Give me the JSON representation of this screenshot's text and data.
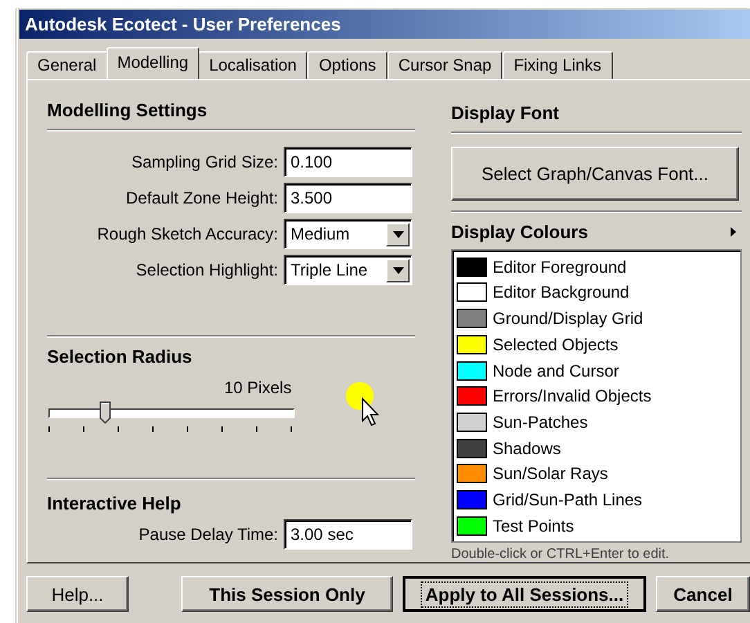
{
  "window": {
    "title": "Autodesk Ecotect - User Preferences"
  },
  "tabs": [
    {
      "label": "General",
      "selected": false
    },
    {
      "label": "Modelling",
      "selected": true
    },
    {
      "label": "Localisation",
      "selected": false
    },
    {
      "label": "Options",
      "selected": false
    },
    {
      "label": "Cursor Snap",
      "selected": false
    },
    {
      "label": "Fixing Links",
      "selected": false
    }
  ],
  "modelling_settings": {
    "heading": "Modelling Settings",
    "fields": [
      {
        "kind": "text",
        "label": "Sampling Grid Size:",
        "value": "0.100"
      },
      {
        "kind": "text",
        "label": "Default Zone Height:",
        "value": "3.500"
      },
      {
        "kind": "dropdown",
        "label": "Rough Sketch Accuracy:",
        "value": "Medium"
      },
      {
        "kind": "dropdown",
        "label": "Selection Highlight:",
        "value": "Triple Line"
      }
    ]
  },
  "selection_radius": {
    "heading": "Selection Radius",
    "reading": "10 Pixels",
    "level": 0.23
  },
  "interactive_help": {
    "heading": "Interactive Help",
    "fields": [
      {
        "kind": "text",
        "label": "Pause Delay Time:",
        "value": "3.00 sec"
      }
    ]
  },
  "display_font": {
    "heading": "Display Font",
    "button": "Select Graph/Canvas Font..."
  },
  "display_colours": {
    "heading": "Display Colours",
    "items": [
      {
        "label": "Editor Foreground",
        "color": "#000000"
      },
      {
        "label": "Editor Background",
        "color": "#ffffff"
      },
      {
        "label": "Ground/Display Grid",
        "color": "#808080"
      },
      {
        "label": "Selected Objects",
        "color": "#ffff00"
      },
      {
        "label": "Node and Cursor",
        "color": "#00ffff"
      },
      {
        "label": "Errors/Invalid Objects",
        "color": "#ff0000"
      },
      {
        "label": "Sun-Patches",
        "color": "#d0d0d0"
      },
      {
        "label": "Shadows",
        "color": "#404040"
      },
      {
        "label": "Sun/Solar Rays",
        "color": "#ff8c00"
      },
      {
        "label": "Grid/Sun-Path Lines",
        "color": "#0000ff"
      },
      {
        "label": "Test Points",
        "color": "#00ff00"
      }
    ],
    "hint": "Double-click or CTRL+Enter to edit."
  },
  "buttons": [
    {
      "label": "Help...",
      "bold": false,
      "focused": false
    },
    {
      "label": "This Session Only",
      "bold": true,
      "focused": false
    },
    {
      "label": "Apply to All Sessions...",
      "bold": true,
      "focused": true
    },
    {
      "label": "Cancel",
      "bold": true,
      "focused": false
    }
  ]
}
